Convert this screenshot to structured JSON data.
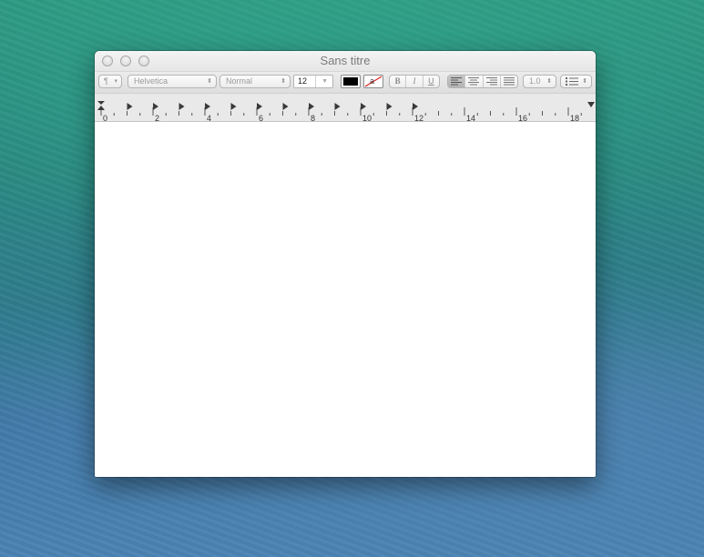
{
  "window": {
    "title": "Sans titre"
  },
  "toolbar": {
    "paragraph_style_label": "¶",
    "font_family": "Helvetica",
    "font_style": "Normal",
    "font_size": "12",
    "text_color": "#000000",
    "background_color_label": "a",
    "bold_label": "B",
    "italic_label": "I",
    "underline_label": "U",
    "line_spacing": "1.0",
    "alignment_active": "left"
  },
  "ruler": {
    "labels": [
      "0",
      "2",
      "4",
      "6",
      "8",
      "10",
      "12",
      "14",
      "16",
      "18"
    ]
  },
  "document": {
    "text": ""
  }
}
